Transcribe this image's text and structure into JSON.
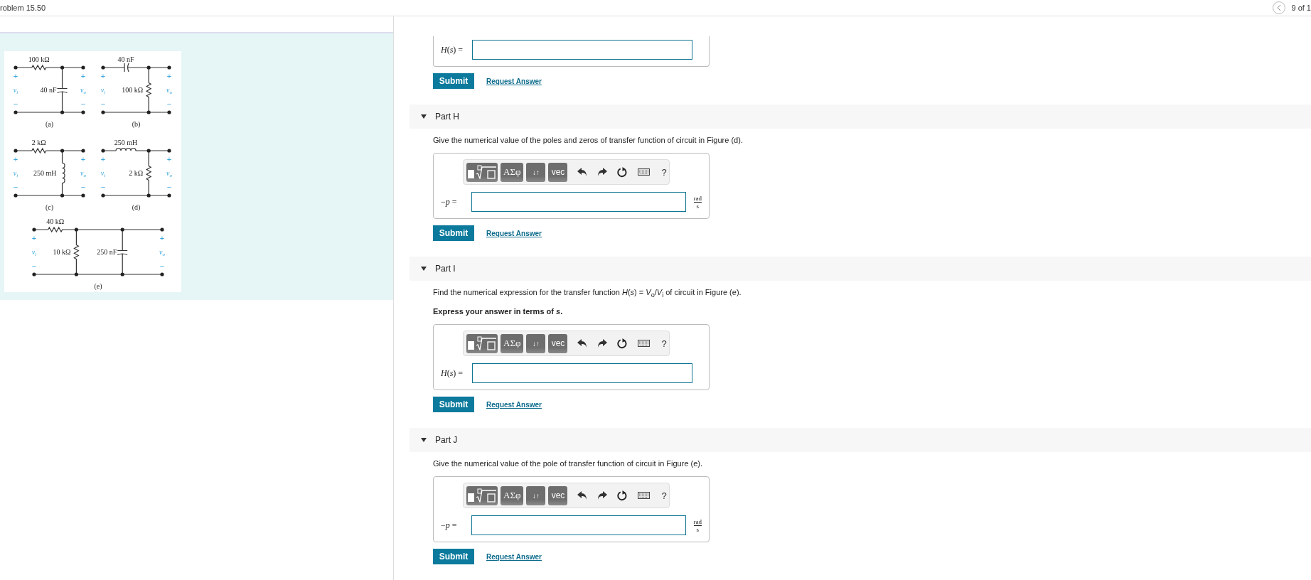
{
  "header": {
    "problem": "roblem 15.50",
    "position": "9 of 1"
  },
  "figure": {
    "circuits": [
      {
        "caption": "(a)",
        "series": {
          "kind": "resistor",
          "value": "100 kΩ"
        },
        "shunts": [
          {
            "kind": "capacitor",
            "value": "40 nF"
          }
        ],
        "input": {
          "symbol": "v",
          "subscript": "i"
        },
        "output": {
          "symbol": "v",
          "subscript": "o"
        },
        "plus": "+",
        "minus": "−"
      },
      {
        "caption": "(b)",
        "series": {
          "kind": "capacitor",
          "value": "40 nF"
        },
        "shunts": [
          {
            "kind": "resistor",
            "value": "100 kΩ"
          }
        ],
        "input": {
          "symbol": "v",
          "subscript": "i"
        },
        "output": {
          "symbol": "v",
          "subscript": "o"
        },
        "plus": "+",
        "minus": "−"
      },
      {
        "caption": "(c)",
        "series": {
          "kind": "resistor",
          "value": "2 kΩ"
        },
        "shunts": [
          {
            "kind": "inductor",
            "value": "250 mH"
          }
        ],
        "input": {
          "symbol": "v",
          "subscript": "i"
        },
        "output": {
          "symbol": "v",
          "subscript": "o"
        },
        "plus": "+",
        "minus": "−"
      },
      {
        "caption": "(d)",
        "series": {
          "kind": "inductor",
          "value": "250 mH"
        },
        "shunts": [
          {
            "kind": "resistor",
            "value": "2 kΩ"
          }
        ],
        "input": {
          "symbol": "v",
          "subscript": "i"
        },
        "output": {
          "symbol": "v",
          "subscript": "o"
        },
        "plus": "+",
        "minus": "−"
      },
      {
        "caption": "(e)",
        "series": {
          "kind": "resistor",
          "value": "40 kΩ"
        },
        "shunts": [
          {
            "kind": "resistor",
            "value": "10 kΩ"
          },
          {
            "kind": "capacitor",
            "value": "250 nF"
          }
        ],
        "input": {
          "symbol": "v",
          "subscript": "i"
        },
        "output": {
          "symbol": "v",
          "subscript": "o"
        },
        "plus": "+",
        "minus": "−"
      }
    ]
  },
  "parts": [
    {
      "kind": "continued",
      "answer": {
        "prefix": "*H*(*s*) ="
      },
      "submit": "Submit",
      "request": "Request Answer"
    },
    {
      "kind": "part",
      "title": "Part H",
      "expanded": true,
      "prompt": "Give the numerical value of the poles and zeros of transfer function of circuit in Figure (d).",
      "answer": {
        "toolbar": [
          {
            "kind": "templates"
          },
          {
            "kind": "greek",
            "text": "ΑΣφ"
          },
          {
            "kind": "arrows",
            "text": "↓↑"
          },
          {
            "kind": "vec",
            "text": "vec"
          },
          {
            "kind": "undo"
          },
          {
            "kind": "redo"
          },
          {
            "kind": "reset"
          },
          {
            "kind": "keyboard"
          },
          {
            "kind": "help",
            "text": "?"
          }
        ],
        "prefix": "−*p* =",
        "unit": {
          "numerator": "rad",
          "denominator": "s"
        }
      },
      "submit": "Submit",
      "request": "Request Answer"
    },
    {
      "kind": "part",
      "title": "Part I",
      "expanded": true,
      "prompt": "Find the numerical expression for the transfer function *H*(*s*) = *V*$_{o}$/*V*$_{i}$ of circuit in Figure (e).",
      "instruction": "Express your answer in terms of *s*.",
      "answer": {
        "toolbar": [
          {
            "kind": "templates"
          },
          {
            "kind": "greek",
            "text": "ΑΣφ"
          },
          {
            "kind": "arrows",
            "text": "↓↑"
          },
          {
            "kind": "vec",
            "text": "vec"
          },
          {
            "kind": "undo"
          },
          {
            "kind": "redo"
          },
          {
            "kind": "reset"
          },
          {
            "kind": "keyboard"
          },
          {
            "kind": "help",
            "text": "?"
          }
        ],
        "prefix": "*H*(*s*) ="
      },
      "submit": "Submit",
      "request": "Request Answer"
    },
    {
      "kind": "part",
      "title": "Part J",
      "expanded": true,
      "prompt": "Give the numerical value of the pole of transfer function of circuit in Figure (e).",
      "answer": {
        "toolbar": [
          {
            "kind": "templates"
          },
          {
            "kind": "greek",
            "text": "ΑΣφ"
          },
          {
            "kind": "arrows",
            "text": "↓↑"
          },
          {
            "kind": "vec",
            "text": "vec"
          },
          {
            "kind": "undo"
          },
          {
            "kind": "redo"
          },
          {
            "kind": "reset"
          },
          {
            "kind": "keyboard"
          },
          {
            "kind": "help",
            "text": "?"
          }
        ],
        "prefix": "−*p* =",
        "unit": {
          "numerator": "rad",
          "denominator": "s"
        }
      },
      "submit": "Submit",
      "request": "Request Answer"
    }
  ]
}
